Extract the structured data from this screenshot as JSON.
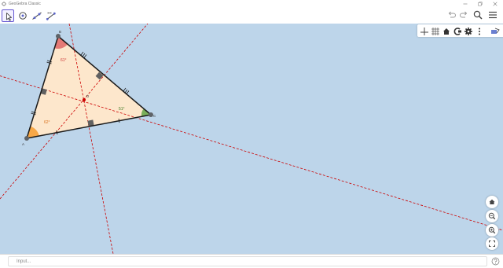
{
  "window": {
    "title": "GeoGebra Classic",
    "controls": [
      "minimize",
      "restore",
      "close"
    ]
  },
  "toolbar": {
    "tools": [
      {
        "name": "move-tool",
        "icon": "cursor-arrow-icon",
        "selected": true
      },
      {
        "name": "point-tool",
        "icon": "circle-point-icon",
        "selected": false
      },
      {
        "name": "line-tool",
        "icon": "line-through-points-icon",
        "selected": false
      },
      {
        "name": "segment-length-tool",
        "icon": "segment-icon",
        "selected": false
      }
    ],
    "right": [
      "undo-icon",
      "redo-icon",
      "search-icon",
      "menu-icon"
    ]
  },
  "style_bar": {
    "buttons": [
      "axes-icon",
      "grid-icon",
      "home-icon",
      "point-capture-icon",
      "settings-icon",
      "more-icon",
      "toggle-style-bar-icon"
    ]
  },
  "construction": {
    "vertices": [
      {
        "label": "B",
        "angle": "61°",
        "color": "#e06666"
      },
      {
        "label": "A",
        "angle": "62°",
        "color": "#f6a13a"
      },
      {
        "label": "C",
        "angle": "51°",
        "color": "#6aa84f"
      }
    ],
    "circumcenter_label": "D",
    "colors": {
      "triangle_fill": "#fde7cc",
      "bisector_line": "#cc0000",
      "edge": "#1a1a1a",
      "vertex_point": "#5f6368",
      "right_angle_mark": "#616161",
      "background": "#bdd5ea"
    }
  },
  "zoom_controls": [
    "home-icon",
    "zoom-out-icon",
    "zoom-in-icon",
    "fullscreen-icon"
  ],
  "input_bar": {
    "placeholder": "Input..."
  }
}
